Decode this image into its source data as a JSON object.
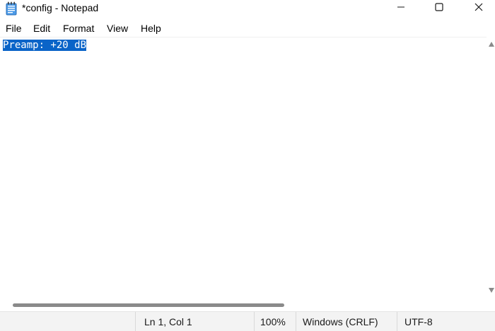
{
  "window": {
    "title": "*config - Notepad",
    "app_icon": "notepad-icon",
    "controls": [
      "minimize-icon",
      "maximize-icon",
      "close-icon"
    ]
  },
  "menu": {
    "items": [
      {
        "label": "File"
      },
      {
        "label": "Edit"
      },
      {
        "label": "Format"
      },
      {
        "label": "View"
      },
      {
        "label": "Help"
      }
    ]
  },
  "editor": {
    "content": "Preamp: +20 dB",
    "selection_color": "#0a64c8"
  },
  "status_bar": {
    "position": "Ln 1, Col 1",
    "zoom": "100%",
    "line_ending": "Windows (CRLF)",
    "encoding": "UTF-8"
  }
}
